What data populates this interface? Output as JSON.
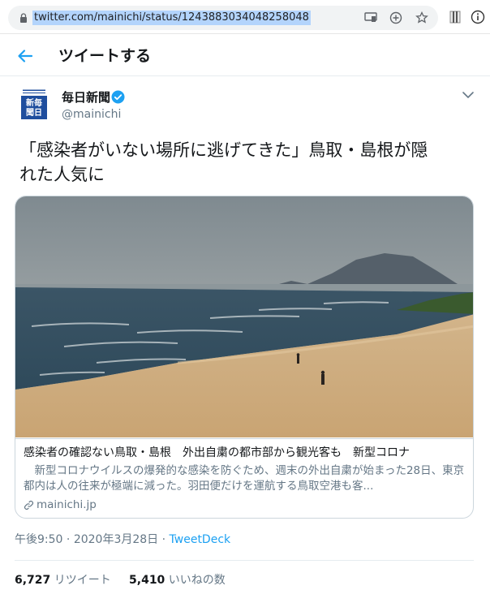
{
  "browser": {
    "url": "twitter.com/mainichi/status/1243883034048258048"
  },
  "header": {
    "title": "ツイートする"
  },
  "author": {
    "name": "毎日新聞",
    "handle": "@mainichi",
    "avatar_text": "毎日新聞"
  },
  "tweet": {
    "line1": "「感染者がいない場所に逃げてきた」鳥取・島根が隠",
    "line2": "れた人気に"
  },
  "card": {
    "title": "感染者の確認ない鳥取・島根　外出自粛の都市部から観光客も　新型コロナ",
    "description": "新型コロナウイルスの爆発的な感染を防ぐため、週末の外出自粛が始まった28日、東京都内は人の往来が極端に減った。羽田便だけを運航する鳥取空港も客...",
    "domain": "mainichi.jp"
  },
  "meta": {
    "time": "午後9:50",
    "date": "2020年3月28日",
    "separator": "·",
    "source": "TweetDeck"
  },
  "stats": {
    "retweets": "6,727",
    "retweets_label": "リツイート",
    "likes": "5,410",
    "likes_label": "いいねの数"
  },
  "colors": {
    "accent": "#1da1f2",
    "text": "#14171a",
    "secondary": "#657786",
    "avatar_blue": "#1f4e9e"
  }
}
